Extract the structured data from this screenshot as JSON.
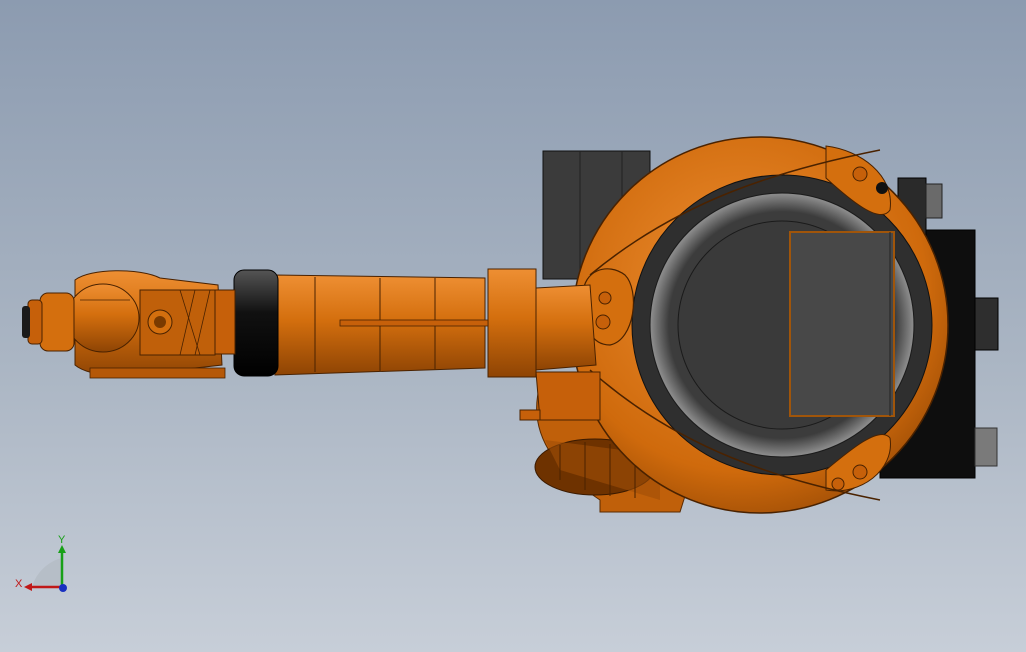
{
  "viewport": {
    "background_top": "#8c9bb0",
    "background_bottom": "#c7ced8"
  },
  "model": {
    "body_color": "#d46f0e",
    "body_dark": "#9e4c05",
    "body_light": "#ee8f33",
    "motor_color": "#3d3d3d",
    "black_part": "#151515",
    "seal_color": "#5a5a5a"
  },
  "triad": {
    "x_label": "X",
    "y_label": "Y",
    "x_color": "#c01818",
    "y_color": "#18a018",
    "z_color": "#1830c0"
  }
}
